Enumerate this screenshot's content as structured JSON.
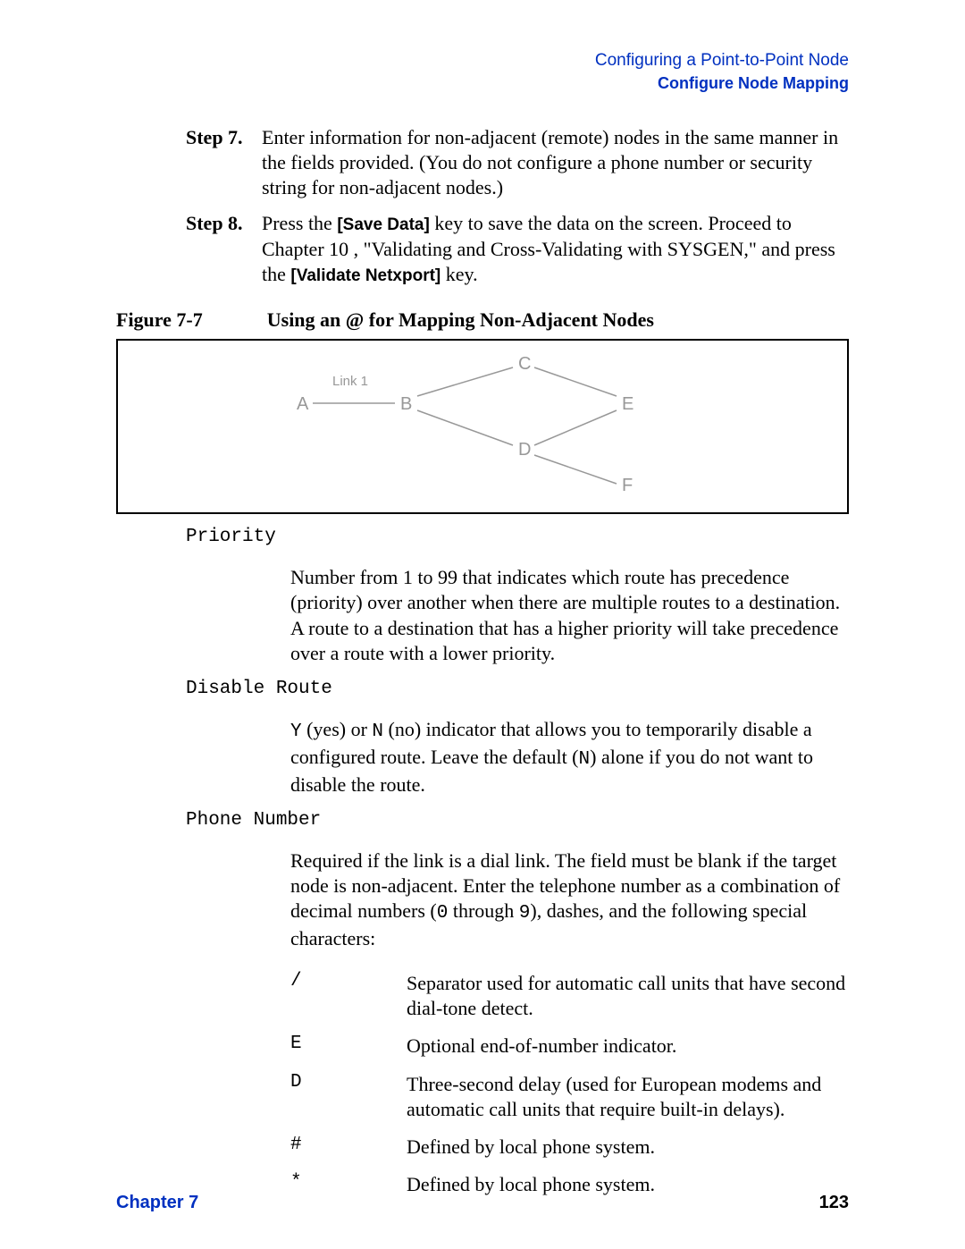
{
  "header": {
    "line1": "Configuring a Point-to-Point Node",
    "line2": "Configure Node Mapping"
  },
  "steps": [
    {
      "marker": "Step 7.",
      "body_before": " Enter information for non-adjacent (remote) nodes in the same manner in the fields provided. (You do not configure a phone number or security string for non-adjacent nodes.)"
    },
    {
      "marker": "Step 8.",
      "body_before": " Press the ",
      "key1": "[Save Data]",
      "body_mid": " key to save the data on the screen. Proceed to Chapter 10 , \"Validating and Cross-Validating with SYSGEN,\" and press the ",
      "key2": "[Validate Netxport]",
      "body_after": " key."
    }
  ],
  "figure": {
    "label": "Figure 7-7",
    "caption": "Using an @ for Mapping Non-Adjacent Nodes",
    "link_label": "Link 1",
    "nodes": {
      "A": "A",
      "B": "B",
      "C": "C",
      "D": "D",
      "E": "E",
      "F": "F"
    }
  },
  "terms": [
    {
      "name": "Priority",
      "def": "Number from 1 to 99 that indicates which route has precedence (priority) over another when there are multiple routes to a destination. A route to a destination that has a higher priority will take precedence over a route with a lower priority."
    },
    {
      "name": "Disable Route",
      "def_parts": {
        "p1": "Y",
        "p2": " (yes) or ",
        "p3": "N",
        "p4": " (no) indicator that allows you to temporarily disable a configured route. Leave the default (",
        "p5": "N",
        "p6": ") alone if you do not want to disable the route."
      }
    },
    {
      "name": "Phone Number",
      "def_parts": {
        "p1": "Required if the link is a dial link. The field must be blank if the target node is non-adjacent. Enter the telephone number as a combination of decimal numbers (",
        "p2": "0",
        "p3": " through ",
        "p4": "9",
        "p5": "), dashes, and the following special characters:"
      }
    }
  ],
  "chars": [
    {
      "sym": "/",
      "desc": "Separator used for automatic call units that have second dial-tone detect."
    },
    {
      "sym": "E",
      "desc": "Optional end-of-number indicator."
    },
    {
      "sym": "D",
      "desc": "Three-second delay (used for European modems and automatic call units that require built-in delays)."
    },
    {
      "sym": "#",
      "desc": "Defined by local phone system."
    },
    {
      "sym": "*",
      "desc": "Defined by local phone system."
    }
  ],
  "footer": {
    "chapter": "Chapter 7",
    "page": "123"
  }
}
